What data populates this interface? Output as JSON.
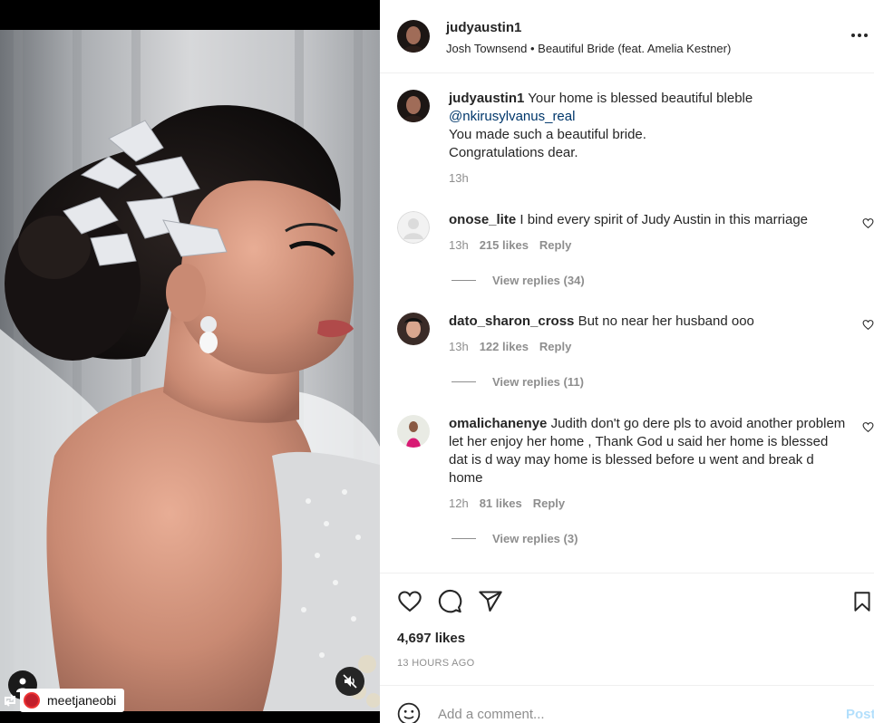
{
  "post": {
    "username": "judyaustin1",
    "audio": "Josh Townsend • Beautiful Bride (feat. Amelia Kestner)",
    "caption": {
      "user": "judyaustin1",
      "text1": "Your home is blessed beautiful bleble",
      "mention": "@nkirusylvanus_real",
      "line2": "You made such a beautiful bride.",
      "line3": "Congratulations dear.",
      "time": "13h"
    },
    "comments": [
      {
        "user": "onose_lite",
        "text": "I bind every spirit of Judy Austin in this marriage",
        "time": "13h",
        "likes": "215 likes",
        "reply": "Reply",
        "view_replies": "View replies (34)"
      },
      {
        "user": "dato_sharon_cross",
        "text": "But no near her husband ooo",
        "time": "13h",
        "likes": "122 likes",
        "reply": "Reply",
        "view_replies": "View replies (11)"
      },
      {
        "user": "omalichanenye",
        "text": "Judith don't go dere pls to avoid another problem let her enjoy her home , Thank God u said her home is blessed dat is d way may home is blessed before u went and break d home",
        "time": "12h",
        "likes": "81 likes",
        "reply": "Reply",
        "view_replies": "View replies (3)"
      }
    ],
    "likes_count": "4,697 likes",
    "time_ago": "13 HOURS AGO",
    "add_comment_placeholder": "Add a comment...",
    "post_button": "Post",
    "more_label": "..."
  },
  "media": {
    "repost_username": "meetjaneobi",
    "icons": [
      "user-tag-icon",
      "mute-icon",
      "repost-icon"
    ]
  },
  "colors": {
    "mention": "#00376b",
    "secondary_text": "#8e8e8e",
    "post_button": "#b2dffc"
  }
}
